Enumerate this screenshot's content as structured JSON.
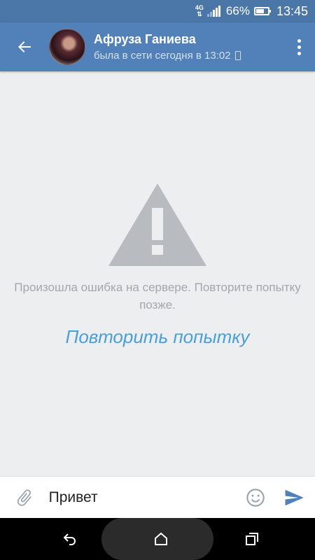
{
  "status_bar": {
    "network": "4G",
    "battery": "66%",
    "battery_level": 0.66,
    "time": "13:45"
  },
  "header": {
    "back_icon": "arrow-left-icon",
    "name": "Афруза Ганиева",
    "status": "была в сети сегодня в 13:02",
    "status_device_icon": "phone-icon",
    "menu_icon": "more-vertical-icon"
  },
  "error": {
    "icon": "warning-icon",
    "message": "Произошла ошибка на сервере. Повторите попытку позже.",
    "retry_label": "Повторить попытку"
  },
  "composer": {
    "attach_icon": "paperclip-icon",
    "value": "Привет",
    "emoji_icon": "smile-icon",
    "send_icon": "send-icon"
  },
  "nav_bar": {
    "back_icon": "nav-back-icon",
    "home_icon": "home-icon",
    "recents_icon": "recents-icon"
  },
  "colors": {
    "header": "#5181b8",
    "status_bar": "#4a76a8",
    "background": "#edeef0",
    "link": "#4a9fd8",
    "muted_text": "#a2a7ad"
  }
}
